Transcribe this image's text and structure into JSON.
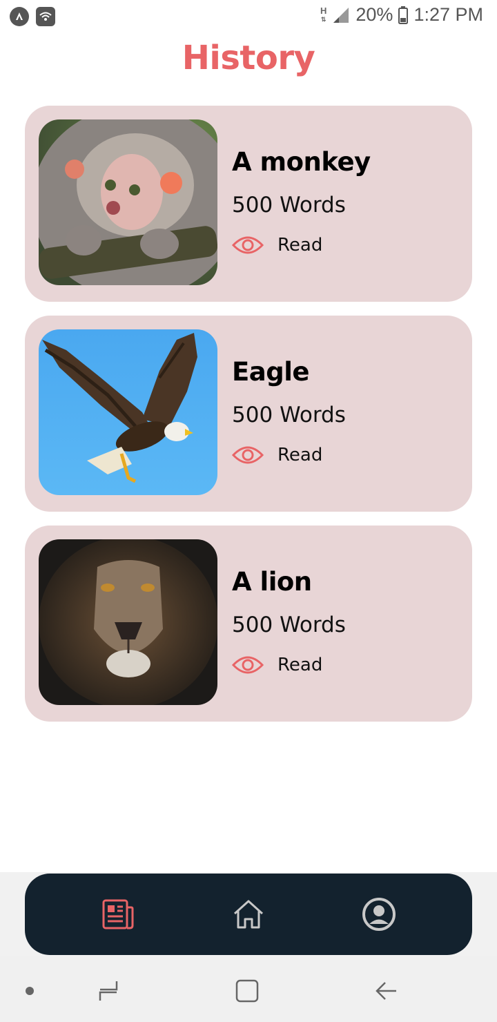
{
  "status_bar": {
    "battery": "20%",
    "time": "1:27 PM",
    "network_type": "H"
  },
  "header": {
    "title": "History"
  },
  "cards": [
    {
      "title": "A monkey",
      "words": "500 Words",
      "read_label": "Read",
      "image": "monkey-photo"
    },
    {
      "title": "Eagle",
      "words": "500 Words",
      "read_label": "Read",
      "image": "eagle-photo"
    },
    {
      "title": "A lion",
      "words": "500 Words",
      "read_label": "Read",
      "image": "lion-photo"
    }
  ],
  "bottom_nav": {
    "items": [
      {
        "icon": "newspaper-icon",
        "active": true
      },
      {
        "icon": "home-icon",
        "active": false
      },
      {
        "icon": "account-circle-icon",
        "active": false
      }
    ]
  },
  "colors": {
    "accent": "#e86466",
    "card_bg": "#e8d5d6",
    "nav_bg": "#13222e",
    "nav_icon": "#c8c8c8"
  }
}
